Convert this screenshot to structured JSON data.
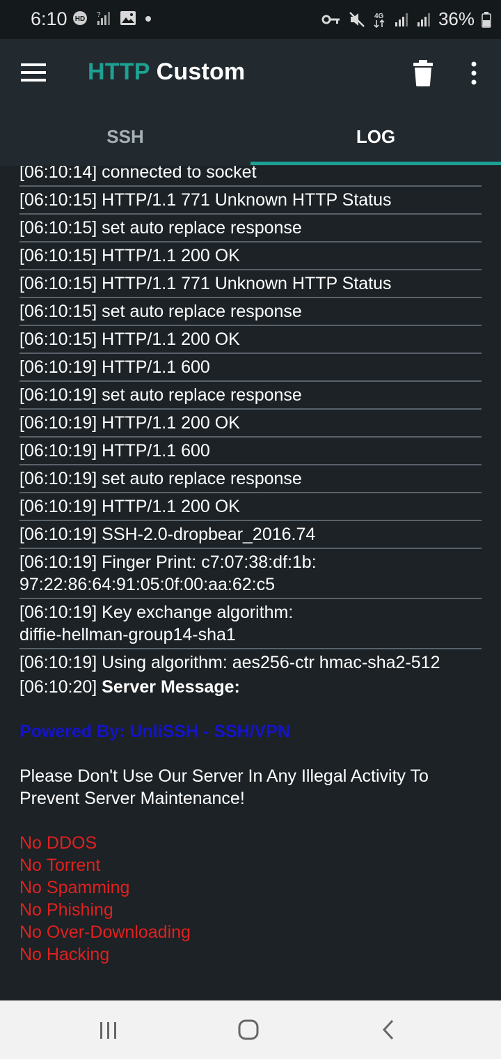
{
  "status_bar": {
    "time": "6:10",
    "battery_percent": "36%",
    "icons": [
      "hd-voice-icon",
      "no-signal-icon",
      "image-icon",
      "dot-icon",
      "vpn-key-icon",
      "mute-icon",
      "4g-icon",
      "signal-icon",
      "signal-icon-2",
      "battery-icon"
    ]
  },
  "app_bar": {
    "title_part1": "HTTP",
    "title_part2": " Custom",
    "accent_color": "#1da193"
  },
  "tabs": [
    {
      "label": "SSH",
      "selected": false
    },
    {
      "label": "LOG",
      "selected": true
    }
  ],
  "log": {
    "partial_top": "[06:10:14] connected to socket",
    "entries": [
      "[06:10:15] HTTP/1.1 771 Unknown HTTP Status",
      "[06:10:15] set auto replace response",
      "[06:10:15] HTTP/1.1 200 OK",
      "[06:10:15] HTTP/1.1 771 Unknown HTTP Status",
      "[06:10:15] set auto replace response",
      "[06:10:15] HTTP/1.1 200 OK",
      "[06:10:19] HTTP/1.1 600",
      "[06:10:19] set auto replace response",
      "[06:10:19] HTTP/1.1 200 OK",
      "[06:10:19] HTTP/1.1 600",
      "[06:10:19] set auto replace response",
      "[06:10:19] HTTP/1.1 200 OK",
      "[06:10:19] SSH-2.0-dropbear_2016.74",
      "[06:10:19] Finger Print: c7:07:38:df:1b:\n97:22:86:64:91:05:0f:00:aa:62:c5",
      "[06:10:19] Key exchange algorithm:\ndiffie-hellman-group14-sha1",
      "[06:10:19] Using algorithm: aes256-ctr hmac-sha2-512"
    ],
    "server_message_time": "[06:10:20] ",
    "server_message_label": "Server Message:",
    "powered_by": "Powered By: UnliSSH - SSH/VPN",
    "notice": "Please Don't Use Our Server In Any Illegal Activity To Prevent Server Maintenance!",
    "rules": [
      "No DDOS",
      "No Torrent",
      "No Spamming",
      "No Phishing",
      "No Over-Downloading",
      "No Hacking"
    ],
    "colors": {
      "powered_by": "#1414c8",
      "rules": "#e0211f"
    }
  },
  "nav_bar": {
    "icons": [
      "recent-apps-icon",
      "home-icon",
      "back-icon"
    ]
  }
}
